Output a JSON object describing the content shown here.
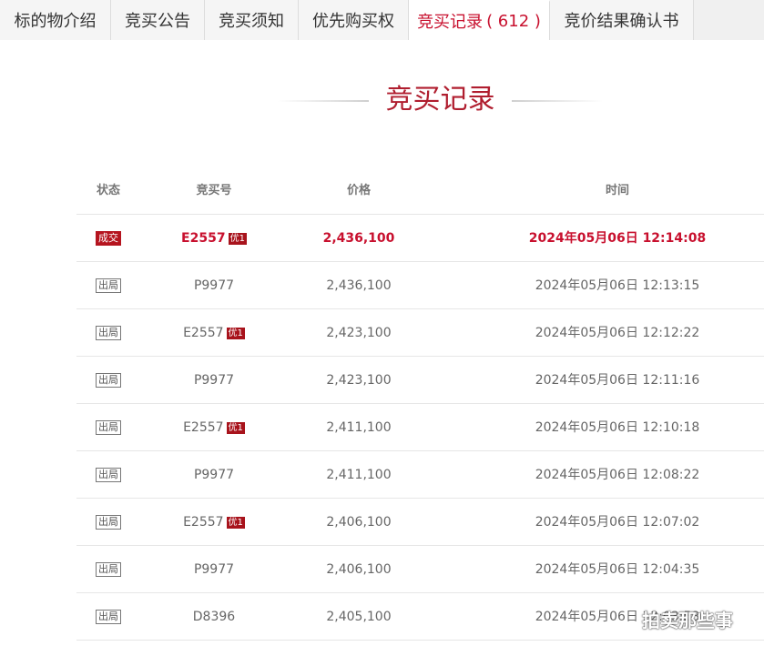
{
  "tabs": [
    {
      "label": "标的物介绍",
      "active": false
    },
    {
      "label": "竞买公告",
      "active": false
    },
    {
      "label": "竞买须知",
      "active": false
    },
    {
      "label": "优先购买权",
      "active": false
    },
    {
      "label": "竞买记录",
      "count": "( 612 )",
      "active": true
    },
    {
      "label": "竞价结果确认书",
      "active": false
    }
  ],
  "section_title": "竞买记录",
  "table": {
    "headers": {
      "status": "状态",
      "bid_no": "竞买号",
      "price": "价格",
      "time": "时间"
    },
    "rows": [
      {
        "status": "成交",
        "won": true,
        "bid_no": "E2557",
        "priority": "优1",
        "price": "2,436,100",
        "time": "2024年05月06日 12:14:08"
      },
      {
        "status": "出局",
        "won": false,
        "bid_no": "P9977",
        "priority": "",
        "price": "2,436,100",
        "time": "2024年05月06日 12:13:15"
      },
      {
        "status": "出局",
        "won": false,
        "bid_no": "E2557",
        "priority": "优1",
        "price": "2,423,100",
        "time": "2024年05月06日 12:12:22"
      },
      {
        "status": "出局",
        "won": false,
        "bid_no": "P9977",
        "priority": "",
        "price": "2,423,100",
        "time": "2024年05月06日 12:11:16"
      },
      {
        "status": "出局",
        "won": false,
        "bid_no": "E2557",
        "priority": "优1",
        "price": "2,411,100",
        "time": "2024年05月06日 12:10:18"
      },
      {
        "status": "出局",
        "won": false,
        "bid_no": "P9977",
        "priority": "",
        "price": "2,411,100",
        "time": "2024年05月06日 12:08:22"
      },
      {
        "status": "出局",
        "won": false,
        "bid_no": "E2557",
        "priority": "优1",
        "price": "2,406,100",
        "time": "2024年05月06日 12:07:02"
      },
      {
        "status": "出局",
        "won": false,
        "bid_no": "P9977",
        "priority": "",
        "price": "2,406,100",
        "time": "2024年05月06日 12:04:35"
      },
      {
        "status": "出局",
        "won": false,
        "bid_no": "D8396",
        "priority": "",
        "price": "2,405,100",
        "time": "2024年05月06日 12:03:58"
      }
    ]
  },
  "watermark": "拍卖那些事",
  "colors": {
    "accent": "#c8102e",
    "badge": "#b5141f"
  }
}
